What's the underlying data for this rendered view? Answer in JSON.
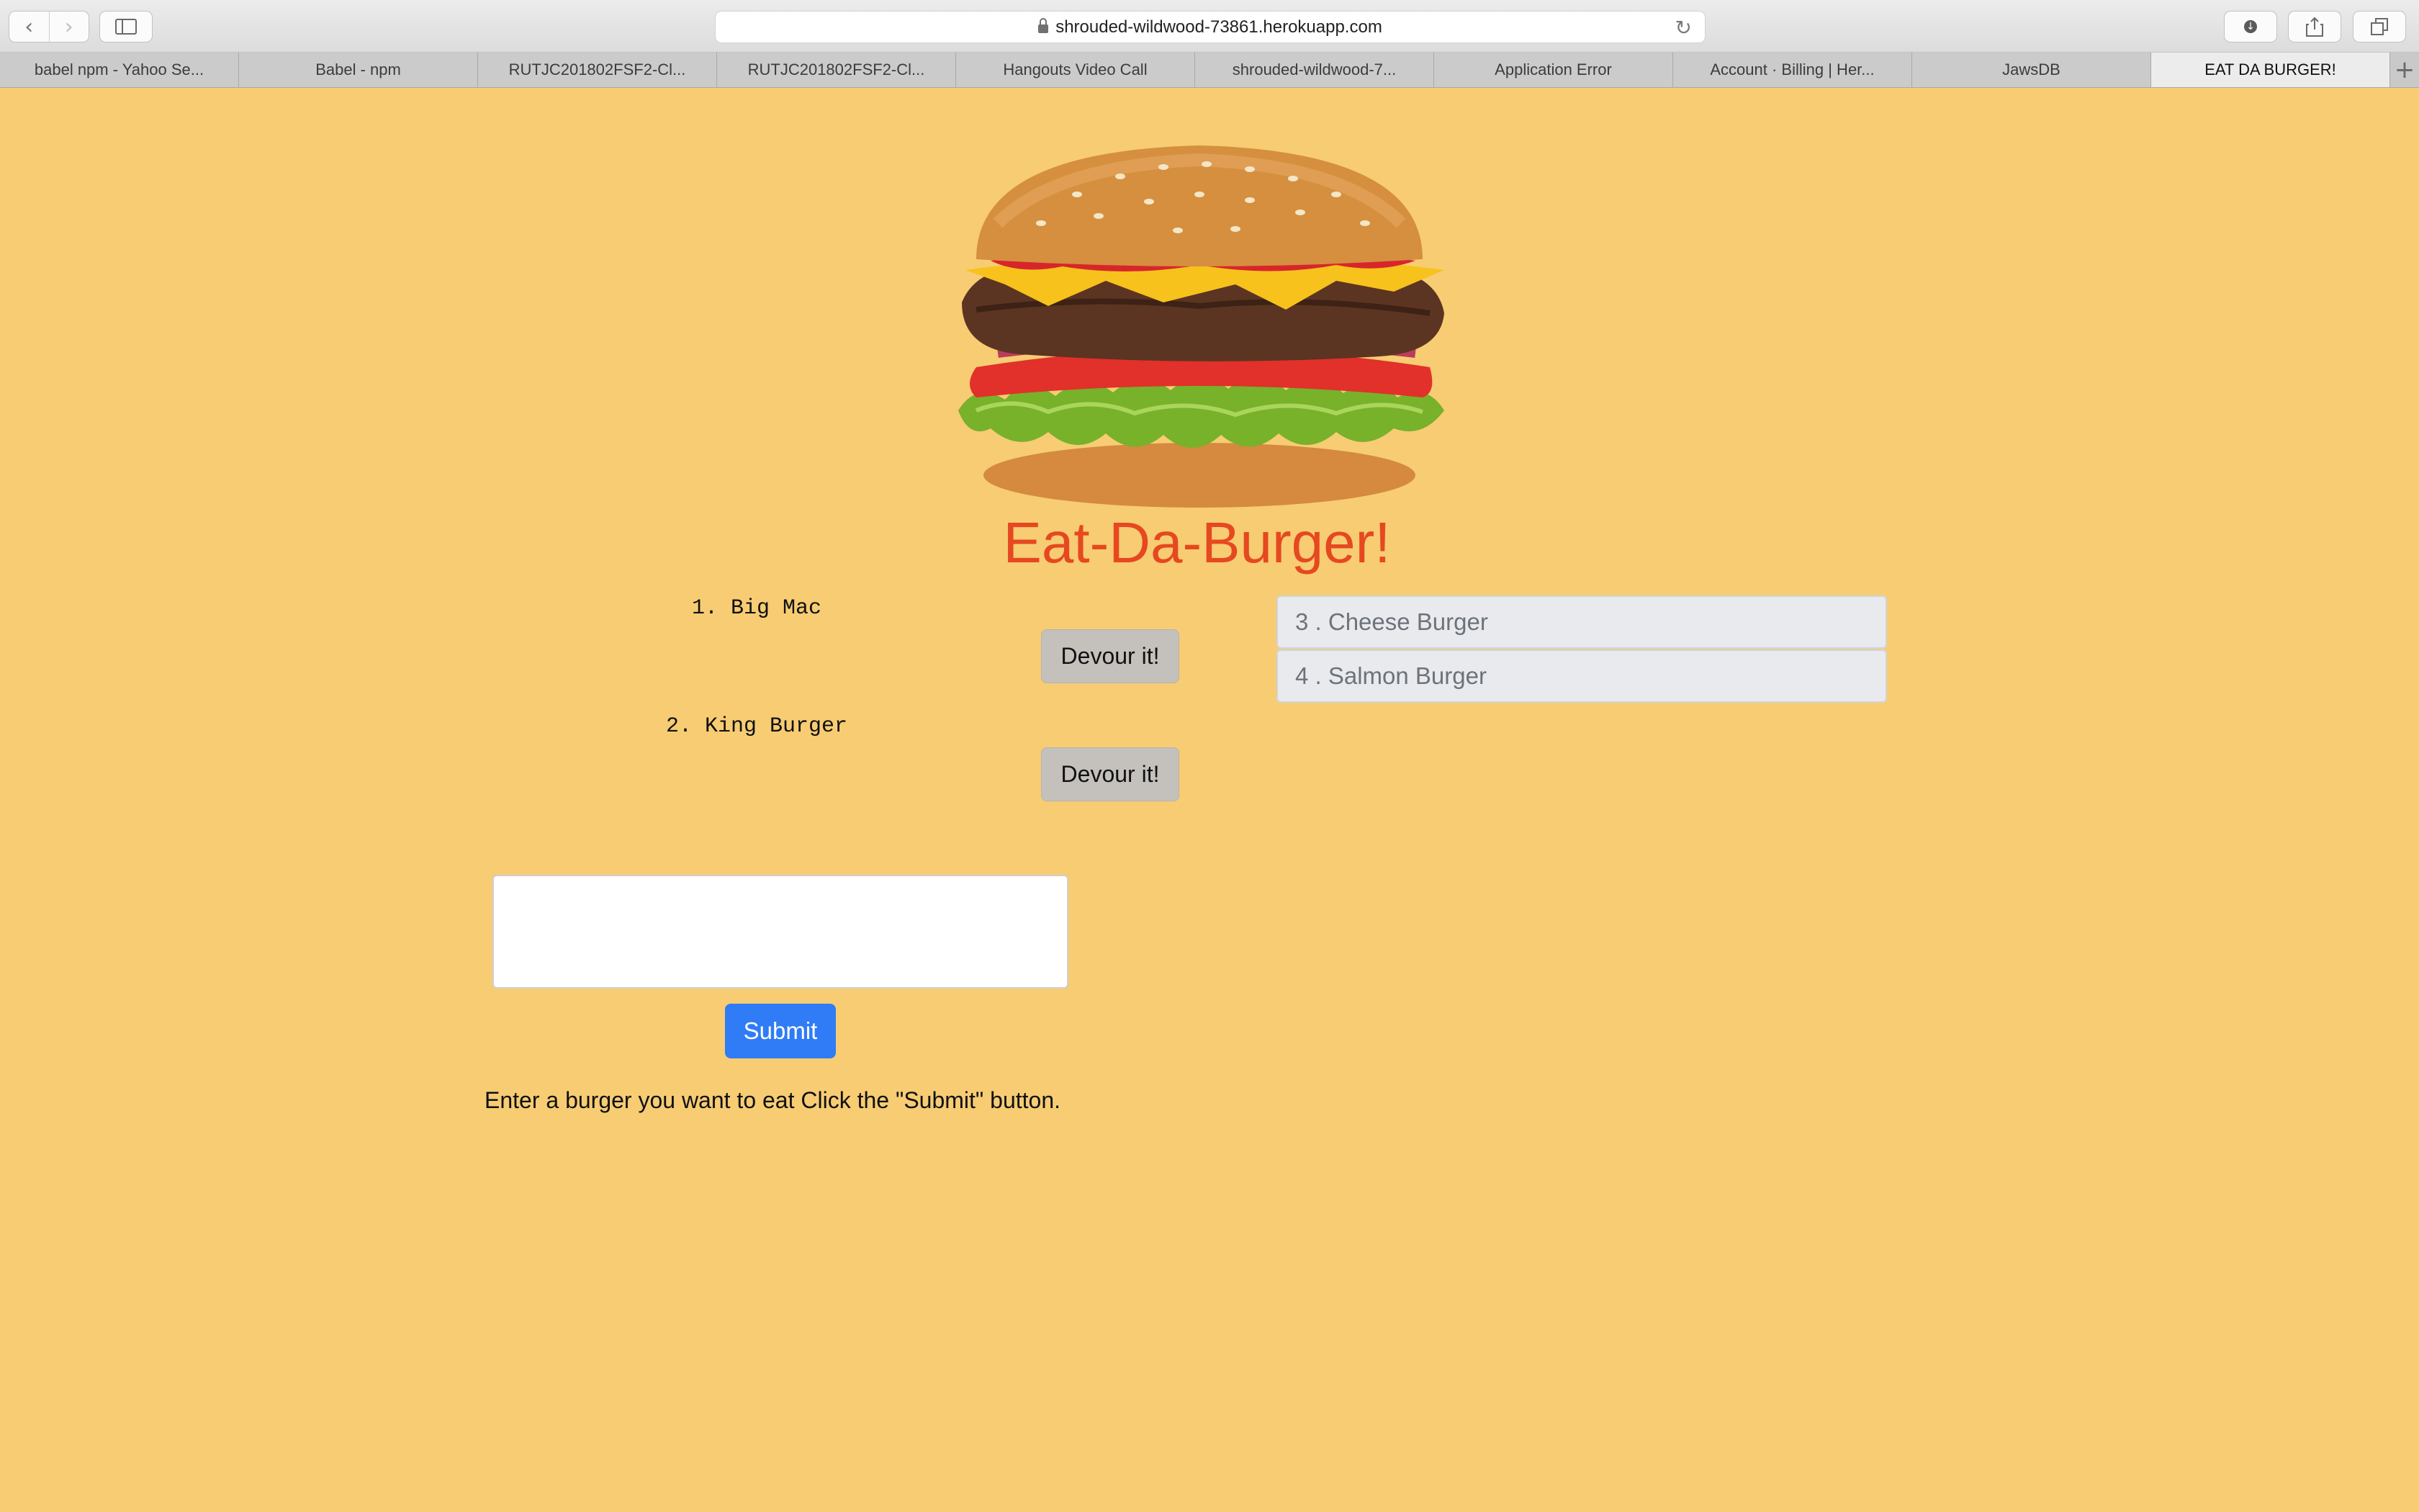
{
  "browser": {
    "url": "shrouded-wildwood-73861.herokuapp.com",
    "tabs": [
      {
        "label": "babel npm - Yahoo Se..."
      },
      {
        "label": "Babel - npm"
      },
      {
        "label": "RUTJC201802FSF2-Cl..."
      },
      {
        "label": "RUTJC201802FSF2-Cl..."
      },
      {
        "label": "Hangouts Video Call"
      },
      {
        "label": "shrouded-wildwood-7..."
      },
      {
        "label": "Application Error"
      },
      {
        "label": "Account · Billing | Her..."
      },
      {
        "label": "JawsDB"
      },
      {
        "label": "EAT DA BURGER!",
        "active": true
      }
    ]
  },
  "page": {
    "title": "Eat-Da-Burger!",
    "uneaten": [
      {
        "text": "1. Big Mac",
        "button": "Devour it!"
      },
      {
        "text": "2. King Burger",
        "button": "Devour it!"
      }
    ],
    "devoured": [
      {
        "text": "3 . Cheese Burger"
      },
      {
        "text": "4 . Salmon Burger"
      }
    ],
    "form": {
      "input_value": "",
      "submit_label": "Submit",
      "instructions": "Enter a burger you want to eat Click the \"Submit\" button."
    }
  },
  "colors": {
    "background": "#f7cc73",
    "title": "#e6481f",
    "submit": "#2f7cf6",
    "devour_button": "#c4c1bd"
  }
}
